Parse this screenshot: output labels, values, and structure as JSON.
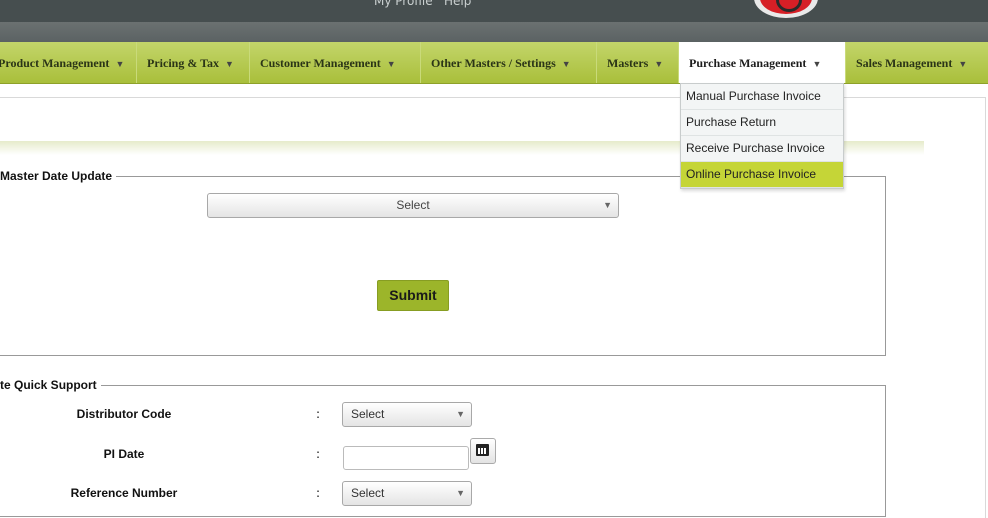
{
  "header": {
    "links": [
      "My Profile",
      "Help"
    ]
  },
  "nav": {
    "items": [
      {
        "label": "Product Management"
      },
      {
        "label": "Pricing & Tax"
      },
      {
        "label": "Customer Management"
      },
      {
        "label": "Other Masters / Settings"
      },
      {
        "label": "Masters"
      },
      {
        "label": "Purchase Management"
      },
      {
        "label": "Sales Management"
      }
    ]
  },
  "dropdown": {
    "items": [
      {
        "label": "Manual Purchase Invoice"
      },
      {
        "label": "Purchase Return"
      },
      {
        "label": "Receive Purchase Invoice"
      },
      {
        "label": "Online Purchase Invoice"
      }
    ]
  },
  "section1": {
    "legend": "Master Date Update",
    "select_value": "Select",
    "submit_label": "Submit"
  },
  "section2": {
    "legend": "te Quick Support",
    "fields": [
      {
        "label": "Distributor Code",
        "value": "Select"
      },
      {
        "label": "PI Date",
        "value": ""
      },
      {
        "label": "Reference Number",
        "value": "Select"
      }
    ],
    "colon": ":"
  },
  "colors": {
    "nav_green": "#b3c84b",
    "highlight": "#c5d537",
    "submit": "#9cb52a",
    "header": "#464e4f"
  }
}
